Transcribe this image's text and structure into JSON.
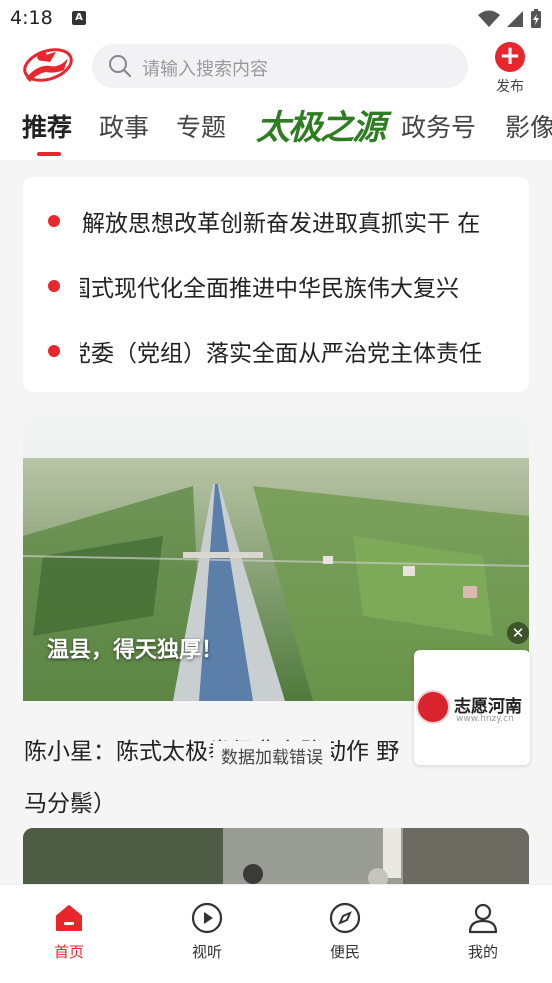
{
  "status_bar": {
    "time": "4:18",
    "notification_letter": "A"
  },
  "header": {
    "search_placeholder": "请输入搜索内容",
    "publish_label": "发布",
    "publish_symbol": "+"
  },
  "tabs": [
    {
      "label": "推荐",
      "active": true
    },
    {
      "label": "政事",
      "active": false
    },
    {
      "label": "专题",
      "active": false
    },
    {
      "label": "太极之源",
      "active": false
    },
    {
      "label": "政务号",
      "active": false
    },
    {
      "label": "影像",
      "active": false
    }
  ],
  "headlines": [
    "解放思想改革创新奋发进取真抓实干 在",
    "国式现代化全面推进中华民族伟大复兴",
    "党委（党组）落实全面从严治党主体责任"
  ],
  "feature": {
    "caption": "温县，得天独厚！"
  },
  "ad": {
    "title": "志愿河南",
    "url": "www.hnzy.cn",
    "close_symbol": "✕"
  },
  "article": {
    "title": "陈小星：陈式太极拳经典套路动作 野马分鬃）"
  },
  "toast": "数据加载错误",
  "bottom_nav": [
    {
      "label": "首页",
      "icon": "home-icon",
      "active": true
    },
    {
      "label": "视听",
      "icon": "play-icon",
      "active": false
    },
    {
      "label": "便民",
      "icon": "compass-icon",
      "active": false
    },
    {
      "label": "我的",
      "icon": "user-icon",
      "active": false
    }
  ],
  "colors": {
    "accent": "#e8262d",
    "special_tab": "#2f7d22"
  }
}
